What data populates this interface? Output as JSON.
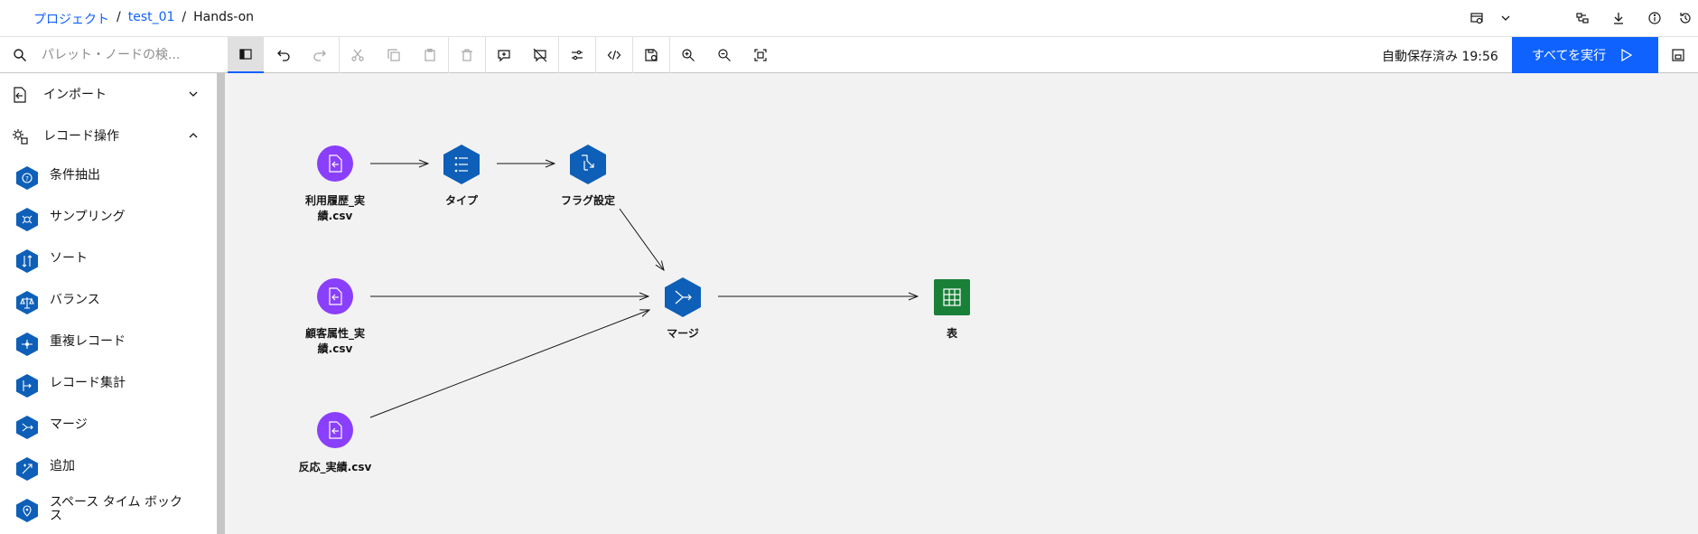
{
  "breadcrumb": {
    "items": [
      "プロジェクト",
      "test_01",
      "Hands-on"
    ],
    "separator": "/"
  },
  "toolbar": {
    "search_placeholder": "パレット・ノードの検...",
    "autosave": "自動保存済み 19:56",
    "run_all": "すべてを実行"
  },
  "sidebar": {
    "categories": [
      {
        "label": "インポート",
        "expanded": false
      },
      {
        "label": "レコード操作",
        "expanded": true
      }
    ],
    "items": [
      {
        "label": "条件抽出",
        "icon": "select-icon"
      },
      {
        "label": "サンプリング",
        "icon": "sample-icon"
      },
      {
        "label": "ソート",
        "icon": "sort-icon"
      },
      {
        "label": "バランス",
        "icon": "balance-icon"
      },
      {
        "label": "重複レコード",
        "icon": "distinct-icon"
      },
      {
        "label": "レコード集計",
        "icon": "aggregate-icon"
      },
      {
        "label": "マージ",
        "icon": "merge-icon"
      },
      {
        "label": "追加",
        "icon": "append-icon"
      },
      {
        "label": "スペース タイム ボックス",
        "icon": "spacetime-icon"
      }
    ]
  },
  "canvas": {
    "nodes": [
      {
        "id": "n1",
        "label": "利用履歴_実\n績.csv",
        "kind": "source"
      },
      {
        "id": "n2",
        "label": "タイプ",
        "kind": "type"
      },
      {
        "id": "n3",
        "label": "フラグ設定",
        "kind": "flag"
      },
      {
        "id": "n4",
        "label": "顧客属性_実\n績.csv",
        "kind": "source"
      },
      {
        "id": "n5",
        "label": "マージ",
        "kind": "merge"
      },
      {
        "id": "n6",
        "label": "表",
        "kind": "table"
      },
      {
        "id": "n7",
        "label": "反応_実績.csv",
        "kind": "source"
      }
    ]
  },
  "colors": {
    "accent": "#0f62fe",
    "source_node": "#8a3ffc",
    "process_node": "#0f62fe",
    "hex_node": "#0e5fb8",
    "output_node": "#198038",
    "canvas_bg": "#f2f2f2"
  }
}
